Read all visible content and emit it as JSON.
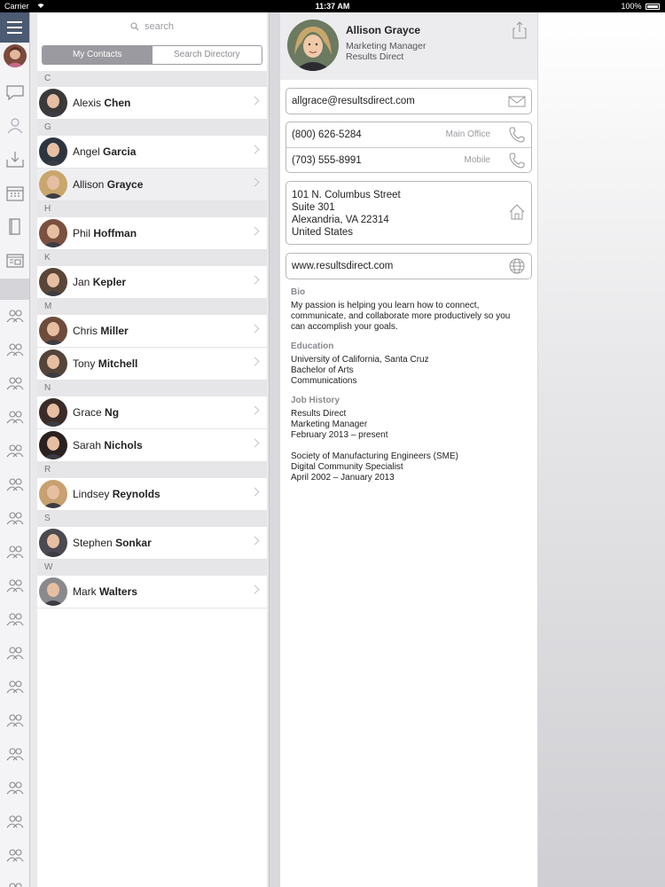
{
  "status_bar": {
    "carrier": "Carrier",
    "time": "11:37 AM",
    "battery": "100%"
  },
  "search": {
    "placeholder": "search"
  },
  "tabs": [
    {
      "label": "My Contacts",
      "active": true
    },
    {
      "label": "Search Directory",
      "active": false
    }
  ],
  "contact_sections": [
    {
      "letter": "C",
      "contacts": [
        {
          "first": "Alexis",
          "last": "Chen",
          "avatar_color": "#3a3a3a"
        }
      ]
    },
    {
      "letter": "G",
      "contacts": [
        {
          "first": "Angel",
          "last": "Garcia",
          "avatar_color": "#2d3540"
        },
        {
          "first": "Allison",
          "last": "Grayce",
          "avatar_color": "#c9a66b",
          "selected": true
        }
      ]
    },
    {
      "letter": "H",
      "contacts": [
        {
          "first": "Phil",
          "last": "Hoffman",
          "avatar_color": "#7a5040"
        }
      ]
    },
    {
      "letter": "K",
      "contacts": [
        {
          "first": "Jan",
          "last": "Kepler",
          "avatar_color": "#5a4638"
        }
      ]
    },
    {
      "letter": "M",
      "contacts": [
        {
          "first": "Chris",
          "last": "Miller",
          "avatar_color": "#6e4c3c"
        },
        {
          "first": "Tony",
          "last": "Mitchell",
          "avatar_color": "#54443a"
        }
      ]
    },
    {
      "letter": "N",
      "contacts": [
        {
          "first": "Grace",
          "last": "Ng",
          "avatar_color": "#3a2c28"
        },
        {
          "first": "Sarah",
          "last": "Nichols",
          "avatar_color": "#2a2220"
        }
      ]
    },
    {
      "letter": "R",
      "contacts": [
        {
          "first": "Lindsey",
          "last": "Reynolds",
          "avatar_color": "#c9a070"
        }
      ]
    },
    {
      "letter": "S",
      "contacts": [
        {
          "first": "Stephen",
          "last": "Sonkar",
          "avatar_color": "#4a4a50"
        }
      ]
    },
    {
      "letter": "W",
      "contacts": [
        {
          "first": "Mark",
          "last": "Walters",
          "avatar_color": "#8a8a8e"
        }
      ]
    }
  ],
  "detail": {
    "name": "Allison Grayce",
    "title": "Marketing Manager",
    "company": "Results Direct",
    "email": "allgrace@resultsdirect.com",
    "phones": [
      {
        "number": "(800) 626-5284",
        "label": "Main Office"
      },
      {
        "number": "(703) 555-8991",
        "label": "Mobile"
      }
    ],
    "address": {
      "line1": "101 N. Columbus Street",
      "line2": "Suite 301",
      "line3": "Alexandria, VA 22314",
      "line4": "United States"
    },
    "website": "www.resultsdirect.com",
    "bio_heading": "Bio",
    "bio": "My passion is helping you learn how to connect, communicate, and collaborate more productively so you can accomplish your goals.",
    "education_heading": "Education",
    "education": [
      "University of California, Santa Cruz",
      "Bachelor of Arts",
      "Communications"
    ],
    "job_heading": "Job History",
    "jobs": [
      [
        "Results Direct",
        "Marketing Manager",
        "February 2013 – present"
      ],
      [
        "Society of Manufacturing Engineers (SME)",
        "Digital Community Specialist",
        "April 2002 – January 2013"
      ]
    ]
  },
  "icons": {
    "rail": [
      "menu-icon",
      "chat-icon",
      "contacts-icon",
      "inbox-download-icon",
      "calendar-icon",
      "book-icon",
      "newsletter-icon"
    ],
    "groups": "groups-icon"
  }
}
